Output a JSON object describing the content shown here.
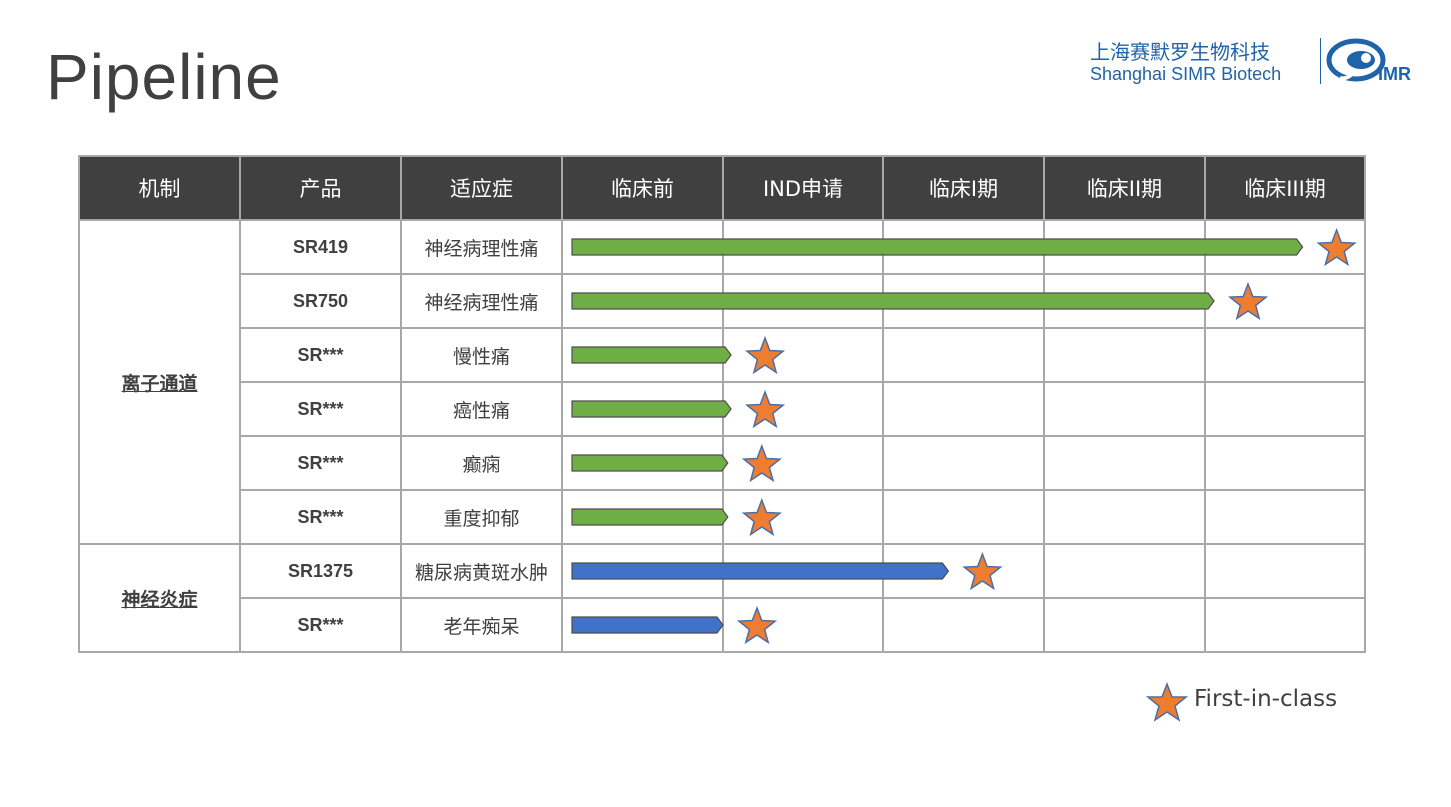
{
  "title": "Pipeline",
  "logo": {
    "company_cn": "上海赛默罗生物科技",
    "company_en": "Shanghai SIMR Biotech",
    "mark_text": "IMR"
  },
  "table": {
    "columns": [
      "机制",
      "产品",
      "适应症",
      "临床前",
      "IND申请",
      "临床I期",
      "临床II期",
      "临床III期"
    ],
    "groups": [
      {
        "mechanism": "离子通道",
        "color": "#5b9b35"
      },
      {
        "mechanism": "神经炎症",
        "color": "#2e5aa6"
      }
    ],
    "rows": [
      {
        "product": "SR419",
        "indication": "神经病理性痛",
        "group": 0,
        "progress_stage": 4.6,
        "first_in_class": true
      },
      {
        "product": "SR750",
        "indication": "神经病理性痛",
        "group": 0,
        "progress_stage": 4.05,
        "first_in_class": true
      },
      {
        "product": "SR***",
        "indication": "慢性痛",
        "group": 0,
        "progress_stage": 1.05,
        "first_in_class": true
      },
      {
        "product": "SR***",
        "indication": "癌性痛",
        "group": 0,
        "progress_stage": 1.05,
        "first_in_class": true
      },
      {
        "product": "SR***",
        "indication": "癫痫",
        "group": 0,
        "progress_stage": 1.03,
        "first_in_class": true
      },
      {
        "product": "SR***",
        "indication": "重度抑郁",
        "group": 0,
        "progress_stage": 1.03,
        "first_in_class": true
      },
      {
        "product": "SR1375",
        "indication": "糖尿病黄斑水肿",
        "group": 1,
        "progress_stage": 2.4,
        "first_in_class": true
      },
      {
        "product": "SR***",
        "indication": "老年痴呆",
        "group": 1,
        "progress_stage": 1.0,
        "first_in_class": true
      }
    ]
  },
  "colors": {
    "header_bg": "#404040",
    "green_bar": "#6fae45",
    "blue_bar": "#3f72c8",
    "star": "#ee7d31",
    "brand_blue": "#1f63a8"
  },
  "legend": {
    "label": "First-in-class",
    "icon": "star-icon"
  }
}
